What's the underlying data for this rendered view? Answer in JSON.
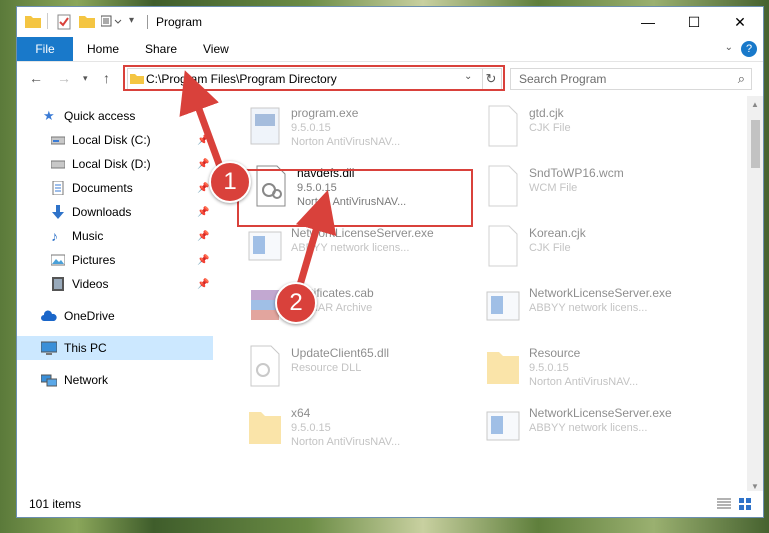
{
  "window": {
    "title": "Program",
    "minimize": "—",
    "maximize": "☐",
    "close": "✕"
  },
  "ribbon": {
    "file": "File",
    "tabs": [
      "Home",
      "Share",
      "View"
    ],
    "help": "?"
  },
  "address": {
    "path": "C:\\Program Files\\Program Directory",
    "search_placeholder": "Search Program"
  },
  "sidebar": {
    "quick_access": "Quick access",
    "items": [
      "Local Disk (C:)",
      "Local Disk (D:)",
      "Documents",
      "Downloads",
      "Music",
      "Pictures",
      "Videos"
    ],
    "onedrive": "OneDrive",
    "this_pc": "This PC",
    "network": "Network"
  },
  "files": {
    "left": [
      {
        "name": "program.exe",
        "line1": "9.5.0.15",
        "line2": "Norton AntiVirusNAV..."
      },
      {
        "name": "navdefs.dll",
        "line1": "9.5.0.15",
        "line2": "Norton AntiVirusNAV..."
      },
      {
        "name": "NetworkLicenseServer.exe",
        "line1": "ABBYY network licens...",
        "line2": ""
      },
      {
        "name": "Certificates.cab",
        "line1": "WinRAR Archive",
        "line2": ""
      },
      {
        "name": "UpdateClient65.dll",
        "line1": "Resource DLL",
        "line2": ""
      },
      {
        "name": "x64",
        "line1": "9.5.0.15",
        "line2": "Norton AntiVirusNAV..."
      }
    ],
    "right": [
      {
        "name": "gtd.cjk",
        "line1": "CJK File",
        "line2": ""
      },
      {
        "name": "SndToWP16.wcm",
        "line1": "WCM File",
        "line2": ""
      },
      {
        "name": "Korean.cjk",
        "line1": "CJK File",
        "line2": ""
      },
      {
        "name": "NetworkLicenseServer.exe",
        "line1": "ABBYY network licens...",
        "line2": ""
      },
      {
        "name": "Resource",
        "line1": "9.5.0.15",
        "line2": "Norton AntiVirusNAV..."
      },
      {
        "name": "NetworkLicenseServer.exe",
        "line1": "ABBYY network licens...",
        "line2": ""
      }
    ]
  },
  "status": {
    "count": "101 items"
  },
  "annotations": {
    "step1": "1",
    "step2": "2",
    "color": "#d9413b"
  }
}
